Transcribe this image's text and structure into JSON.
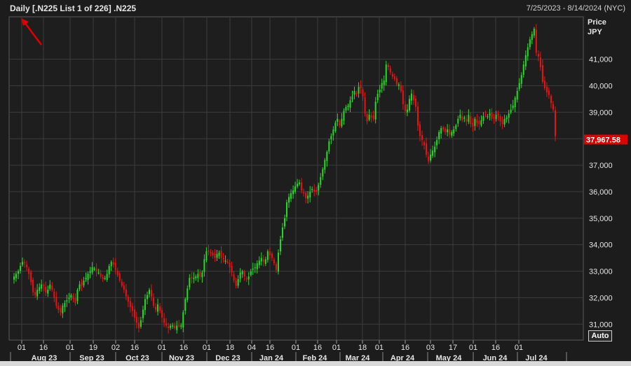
{
  "header": {
    "title": "Daily [.N225 List 1 of 226] .N225",
    "date_range": "7/25/2023 - 8/14/2024 (NYC)"
  },
  "axis": {
    "price_label": "Price",
    "currency_label": "JPY",
    "last_price": "37,967.58",
    "auto_label": "Auto"
  },
  "colors": {
    "background": "#1c1c1c",
    "up": "#22dd22",
    "down": "#ee1111",
    "grid": "#3c3c3c",
    "last_price_tag": "#dd0000",
    "arrow": "#dd0000"
  },
  "chart_data": {
    "type": "candlestick",
    "title": "Daily [.N225 List 1 of 226] .N225",
    "ylabel": "Price JPY",
    "ylim": [
      30400,
      42600
    ],
    "y_ticks": [
      "31,000",
      "32,000",
      "33,000",
      "34,000",
      "35,000",
      "36,000",
      "37,000",
      "38,000",
      "39,000",
      "40,000",
      "41,000"
    ],
    "y_tick_values": [
      31000,
      32000,
      33000,
      34000,
      35000,
      36000,
      37000,
      38000,
      39000,
      40000,
      41000
    ],
    "day_ticks": [
      "01",
      "16",
      "01",
      "19",
      "02",
      "16",
      "01",
      "16",
      "01",
      "18",
      "04",
      "16",
      "01",
      "16",
      "01",
      "18",
      "01",
      "16",
      "03",
      "17",
      "01",
      "16",
      "01"
    ],
    "months": [
      "Aug 23",
      "Sep 23",
      "Oct 23",
      "Nov 23",
      "Dec 23",
      "Jan 24",
      "Feb 24",
      "Mar 24",
      "Apr 24",
      "May 24",
      "Jun 24",
      "Jul 24"
    ],
    "last_price": 37967.58,
    "grid": true,
    "close_series": [
      32800,
      32900,
      33000,
      33200,
      33350,
      33300,
      33150,
      32900,
      32600,
      32200,
      32100,
      32300,
      32400,
      32500,
      32450,
      32200,
      32300,
      32500,
      32300,
      32000,
      31700,
      31550,
      31450,
      31700,
      31800,
      31900,
      32000,
      32100,
      31950,
      31800,
      32300,
      32500,
      32450,
      32650,
      32750,
      32900,
      33000,
      33150,
      33100,
      33000,
      32950,
      32800,
      32700,
      32750,
      32900,
      33200,
      33350,
      33250,
      33050,
      32850,
      32650,
      32450,
      32300,
      32050,
      31850,
      31650,
      31500,
      31250,
      31050,
      30850,
      31150,
      31550,
      31950,
      32100,
      32300,
      32050,
      31700,
      31550,
      31750,
      31500,
      31250,
      31050,
      30950,
      30850,
      30950,
      30950,
      30850,
      30950,
      30950,
      30950,
      31450,
      31950,
      32350,
      32750,
      32750,
      32750,
      32800,
      32900,
      32800,
      32950,
      33450,
      33750,
      33750,
      33700,
      33600,
      33500,
      33650,
      33700,
      33500,
      33450,
      33400,
      33350,
      33150,
      32950,
      32650,
      32450,
      32700,
      32950,
      33000,
      32800,
      32700,
      32800,
      33000,
      33100,
      33150,
      33300,
      33400,
      33500,
      33350,
      33450,
      33750,
      33600,
      33500,
      33300,
      33050,
      33700,
      34200,
      34650,
      35000,
      35600,
      35800,
      35950,
      36050,
      36200,
      36300,
      36350,
      36050,
      35950,
      35750,
      35850,
      36000,
      36100,
      36000,
      36000,
      36250,
      36550,
      36850,
      37200,
      37500,
      37900,
      38100,
      38350,
      38600,
      38750,
      38500,
      38750,
      39050,
      39200,
      39250,
      39450,
      39600,
      39800,
      39700,
      39950,
      39900,
      39600,
      38950,
      38650,
      38900,
      38800,
      38750,
      39400,
      39700,
      39850,
      40100,
      40200,
      40800,
      40700,
      40500,
      40350,
      40250,
      40050,
      40050,
      39800,
      39300,
      39050,
      39100,
      39500,
      39700,
      39450,
      39200,
      38500,
      38100,
      37950,
      37750,
      37400,
      37150,
      37400,
      37550,
      37700,
      37950,
      38250,
      38400,
      38350,
      38250,
      38350,
      38150,
      38250,
      38350,
      38500,
      38750,
      38900,
      38700,
      38800,
      38650,
      38900,
      38550,
      38450,
      38750,
      38600,
      38550,
      38700,
      38850,
      38900,
      38850,
      38950,
      38750,
      38750,
      38900,
      38850,
      38650,
      38550,
      38750,
      38800,
      38950,
      39100,
      39250,
      39550,
      39800,
      40100,
      40400,
      40800,
      41150,
      41450,
      41750,
      41950,
      42150,
      41250,
      41100,
      40700,
      40150,
      39900,
      39750,
      39650,
      39350,
      39100,
      38100
    ]
  }
}
